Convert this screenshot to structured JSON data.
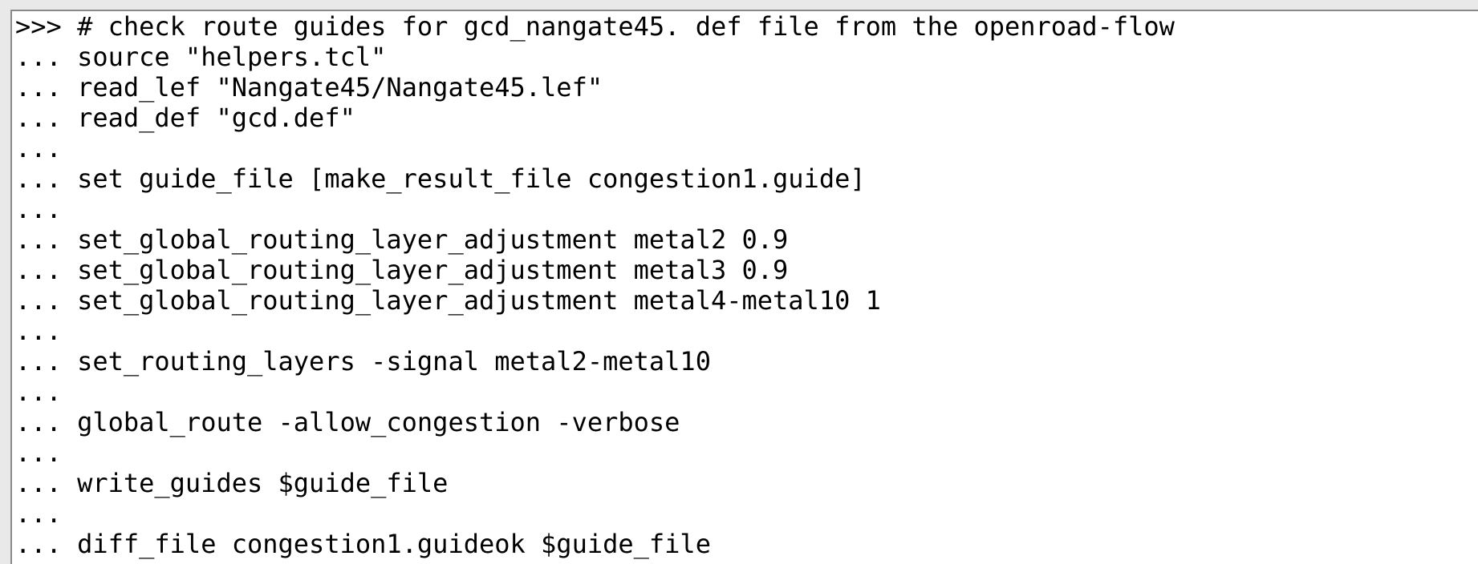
{
  "console": {
    "lines": [
      ">>> # check route guides for gcd_nangate45. def file from the openroad-flow",
      "... source \"helpers.tcl\"",
      "... read_lef \"Nangate45/Nangate45.lef\"",
      "... read_def \"gcd.def\"",
      "...",
      "... set guide_file [make_result_file congestion1.guide]",
      "...",
      "... set_global_routing_layer_adjustment metal2 0.9",
      "... set_global_routing_layer_adjustment metal3 0.9",
      "... set_global_routing_layer_adjustment metal4-metal10 1",
      "...",
      "... set_routing_layers -signal metal2-metal10",
      "...",
      "... global_route -allow_congestion -verbose",
      "...",
      "... write_guides $guide_file",
      "...",
      "... diff_file congestion1.guideok $guide_file"
    ]
  }
}
